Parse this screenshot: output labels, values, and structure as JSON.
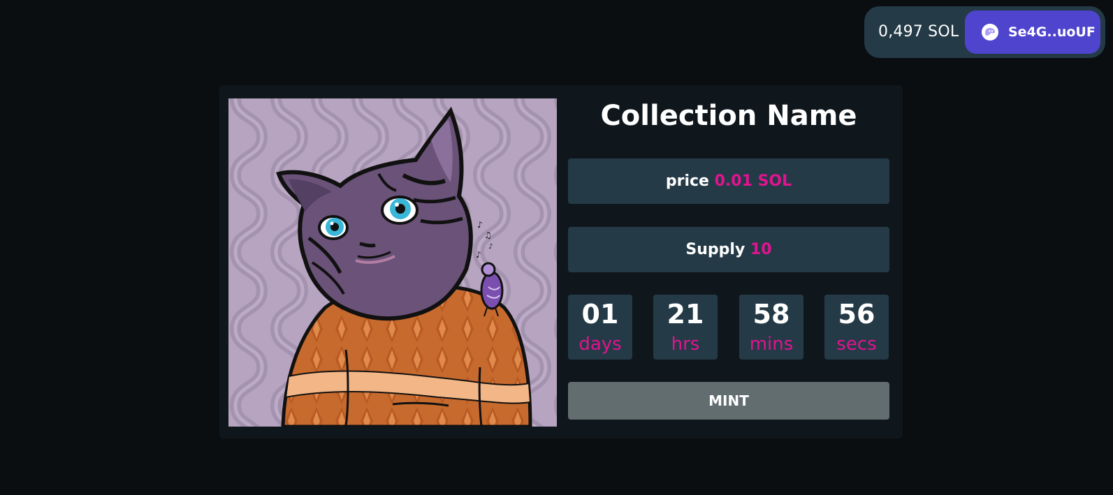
{
  "wallet": {
    "balance": "0,497 SOL",
    "address": "Se4G..uoUF",
    "icon": "phantom-ghost-icon"
  },
  "collection": {
    "name": "Collection Name",
    "price_label": "price",
    "price_value": "0.01 SOL",
    "supply_label": "Supply",
    "supply_value": "10"
  },
  "countdown": {
    "days": "01",
    "days_label": "days",
    "hours": "21",
    "hours_label": "hrs",
    "minutes": "58",
    "minutes_label": "mins",
    "seconds": "56",
    "seconds_label": "secs"
  },
  "mint_button": {
    "label": "MINT"
  },
  "colors": {
    "background": "#0a0e11",
    "card": "#0f171c",
    "panel": "#253a47",
    "accent": "#e0148f",
    "wallet_button": "#4e44ce",
    "mint_button": "#626d6f"
  }
}
